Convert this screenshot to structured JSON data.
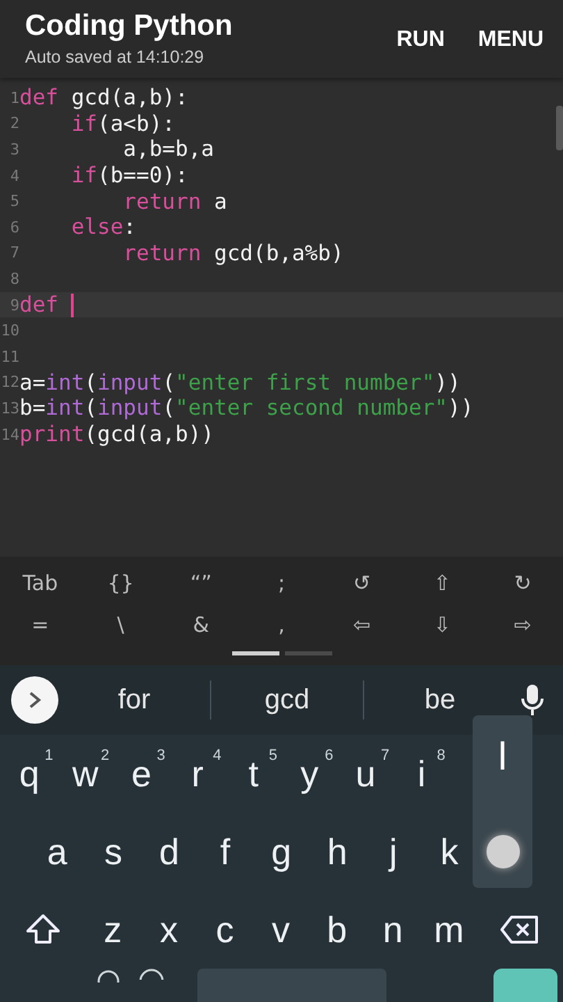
{
  "header": {
    "title": "Coding Python",
    "subtitle": "Auto saved at 14:10:29",
    "actions": [
      "RUN",
      "MENU"
    ]
  },
  "editor": {
    "lines": [
      {
        "number": "1",
        "current": false,
        "tokens": [
          {
            "text": "def",
            "kind": "keyword"
          },
          {
            "text": " gcd(a,b):",
            "kind": "plain"
          }
        ]
      },
      {
        "number": "2",
        "current": false,
        "tokens": [
          {
            "text": "    if",
            "kind": "keyword"
          },
          {
            "text": "(a<b):",
            "kind": "plain"
          }
        ]
      },
      {
        "number": "3",
        "current": false,
        "tokens": [
          {
            "text": "        a,b=b,a",
            "kind": "plain"
          }
        ]
      },
      {
        "number": "4",
        "current": false,
        "tokens": [
          {
            "text": "    if",
            "kind": "keyword"
          },
          {
            "text": "(b==0):",
            "kind": "plain"
          }
        ]
      },
      {
        "number": "5",
        "current": false,
        "tokens": [
          {
            "text": "        return",
            "kind": "keyword"
          },
          {
            "text": " a",
            "kind": "plain"
          }
        ]
      },
      {
        "number": "6",
        "current": false,
        "tokens": [
          {
            "text": "    else",
            "kind": "keyword"
          },
          {
            "text": ":",
            "kind": "plain"
          }
        ]
      },
      {
        "number": "7",
        "current": false,
        "tokens": [
          {
            "text": "        return",
            "kind": "keyword"
          },
          {
            "text": " gcd(b,a%b)",
            "kind": "plain"
          }
        ]
      },
      {
        "number": "8",
        "current": false
      },
      {
        "number": "9",
        "current": true,
        "tokens": [
          {
            "text": "def ",
            "kind": "keyword"
          }
        ]
      },
      {
        "number": "10",
        "current": false
      },
      {
        "number": "11",
        "current": false
      },
      {
        "number": "12",
        "current": false,
        "tokens": [
          {
            "text": "a=",
            "kind": "plain"
          },
          {
            "text": "int",
            "kind": "builtin"
          },
          {
            "text": "(",
            "kind": "plain"
          },
          {
            "text": "input",
            "kind": "builtin"
          },
          {
            "text": "(",
            "kind": "plain"
          },
          {
            "text": "\"enter first number\"",
            "kind": "string"
          },
          {
            "text": "))",
            "kind": "plain"
          }
        ]
      },
      {
        "number": "13",
        "current": false,
        "tokens": [
          {
            "text": "b=",
            "kind": "plain"
          },
          {
            "text": "int",
            "kind": "builtin"
          },
          {
            "text": "(",
            "kind": "plain"
          },
          {
            "text": "input",
            "kind": "builtin"
          },
          {
            "text": "(",
            "kind": "plain"
          },
          {
            "text": "\"enter second number\"",
            "kind": "string"
          },
          {
            "text": "))",
            "kind": "plain"
          }
        ]
      },
      {
        "number": "14",
        "current": false,
        "tokens": [
          {
            "text": "print",
            "kind": "keyword"
          },
          {
            "text": "(gcd(a,b))",
            "kind": "plain"
          }
        ]
      }
    ]
  },
  "extra_keys": {
    "rows": [
      [
        "Tab",
        "{}",
        "“”",
        ";",
        "↺",
        "⇧",
        "↻"
      ],
      [
        "=",
        "\\",
        "&",
        ",",
        "⇦",
        "⇩",
        "⇨"
      ]
    ],
    "pages": [
      {
        "selected": true
      },
      {
        "selected": false
      }
    ]
  },
  "suggestions": [
    "for",
    "gcd",
    "be"
  ],
  "keyboard": {
    "rows": [
      [
        {
          "label": "q",
          "hint": "1"
        },
        {
          "label": "w",
          "hint": "2"
        },
        {
          "label": "e",
          "hint": "3"
        },
        {
          "label": "r",
          "hint": "4"
        },
        {
          "label": "t",
          "hint": "5"
        },
        {
          "label": "y",
          "hint": "6"
        },
        {
          "label": "u",
          "hint": "7"
        },
        {
          "label": "i",
          "hint": "8"
        }
      ],
      [
        {
          "label": "a"
        },
        {
          "label": "s"
        },
        {
          "label": "d"
        },
        {
          "label": "f"
        },
        {
          "label": "g"
        },
        {
          "label": "h"
        },
        {
          "label": "j"
        },
        {
          "label": "k"
        }
      ],
      [
        {
          "kind": "shift"
        },
        {
          "label": "z"
        },
        {
          "label": "x"
        },
        {
          "label": "c"
        },
        {
          "label": "v"
        },
        {
          "label": "b"
        },
        {
          "label": "n"
        },
        {
          "label": "m"
        },
        {
          "kind": "backspace"
        }
      ]
    ],
    "popup": {
      "label": "l"
    }
  }
}
